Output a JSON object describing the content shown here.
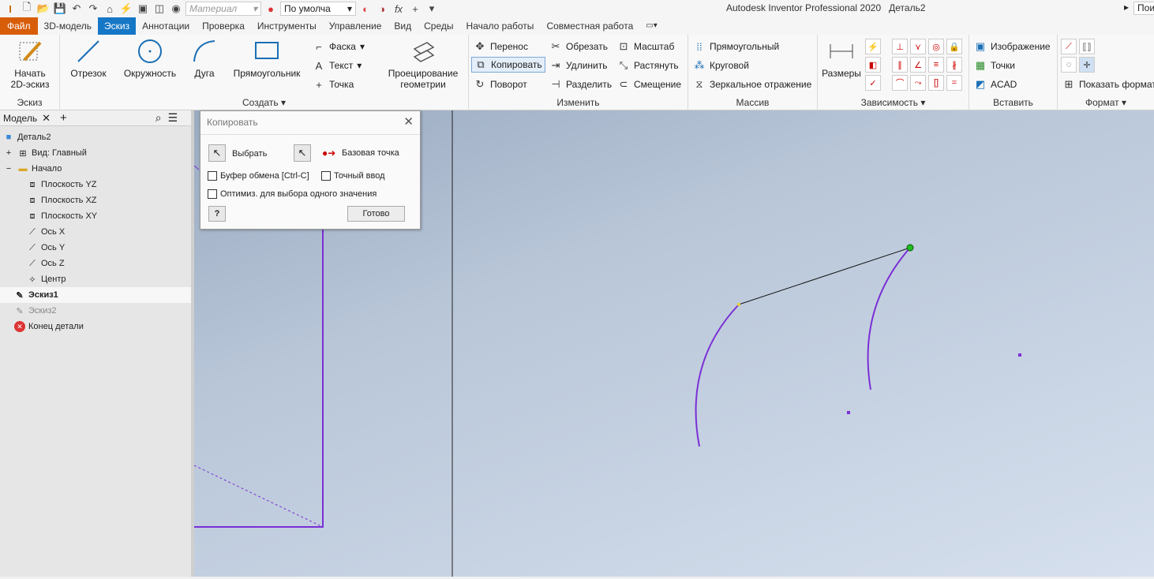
{
  "qat": {
    "material_placeholder": "Материал",
    "appearance_value": "По умолча",
    "window_title": "Autodesk Inventor Professional 2020",
    "document_name": "Деталь2",
    "search_fragment": "Пои"
  },
  "tabs": [
    "Файл",
    "3D-модель",
    "Эскиз",
    "Аннотации",
    "Проверка",
    "Инструменты",
    "Управление",
    "Вид",
    "Среды",
    "Начало работы",
    "Совместная работа"
  ],
  "ribbon": {
    "sketch_panel": {
      "start_label_1": "Начать",
      "start_label_2": "2D-эскиз",
      "panel_label": "Эскиз"
    },
    "create_panel": {
      "line": "Отрезок",
      "circle": "Окружность",
      "arc": "Дуга",
      "rectangle": "Прямоугольник",
      "chamfer": "Фаска",
      "text": "Текст",
      "point": "Точка",
      "project_1": "Проецирование",
      "project_2": "геометрии",
      "panel_label": "Создать"
    },
    "modify_panel": {
      "move": "Перенос",
      "copy": "Копировать",
      "rotate": "Поворот",
      "trim": "Обрезать",
      "extend": "Удлинить",
      "split": "Разделить",
      "scale": "Масштаб",
      "stretch": "Растянуть",
      "offset": "Смещение",
      "panel_label": "Изменить"
    },
    "pattern_panel": {
      "rect": "Прямоугольный",
      "circular": "Круговой",
      "mirror": "Зеркальное отражение",
      "panel_label": "Массив"
    },
    "constrain_panel": {
      "dimension": "Размеры",
      "panel_label": "Зависимость"
    },
    "insert_panel": {
      "image": "Изображение",
      "points": "Точки",
      "acad": "ACAD",
      "panel_label": "Вставить"
    },
    "format_panel": {
      "show_format": "Показать формат",
      "panel_label": "Формат"
    }
  },
  "browser": {
    "tab_label": "Модель",
    "items": [
      {
        "label": "Деталь2"
      },
      {
        "label": "Вид: Главный"
      },
      {
        "label": "Начало"
      },
      {
        "label": "Плоскость YZ"
      },
      {
        "label": "Плоскость XZ"
      },
      {
        "label": "Плоскость XY"
      },
      {
        "label": "Ось X"
      },
      {
        "label": "Ось Y"
      },
      {
        "label": "Ось Z"
      },
      {
        "label": "Центр"
      },
      {
        "label": "Эскиз1"
      },
      {
        "label": "Эскиз2"
      },
      {
        "label": "Конец детали"
      }
    ]
  },
  "dialog": {
    "title": "Копировать",
    "select_label": "Выбрать",
    "base_point_label": "Базовая точка",
    "clipboard_label": "Буфер обмена [Ctrl-C]",
    "precise_label": "Точный ввод",
    "optimize_label": "Оптимиз. для выбора одного значения",
    "done_label": "Готово",
    "help_glyph": "?"
  },
  "colors": {
    "file_tab": "#d85d09",
    "active_tab": "#1677c6",
    "sketch_geometry": "#7b2fd6",
    "selected_point": "#22bb22",
    "base_point": "#cc0000"
  }
}
